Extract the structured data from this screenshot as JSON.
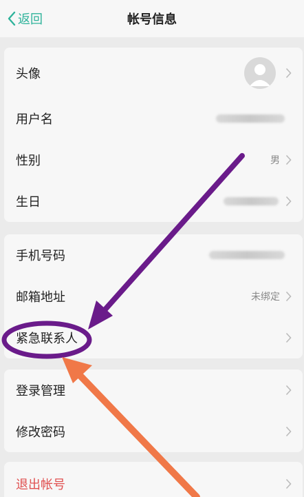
{
  "navbar": {
    "back_label": "返回",
    "title": "帐号信息"
  },
  "group1": {
    "avatar_label": "头像",
    "username_label": "用户名",
    "gender_label": "性别",
    "gender_value": "男",
    "birthday_label": "生日"
  },
  "group2": {
    "phone_label": "手机号码",
    "email_label": "邮箱地址",
    "email_value": "未绑定",
    "emergency_label": "紧急联系人"
  },
  "group3": {
    "login_mgmt_label": "登录管理",
    "change_password_label": "修改密码"
  },
  "group4": {
    "logout_label": "退出帐号"
  },
  "colors": {
    "accent": "#2fb39b",
    "logout": "#e05050",
    "annotation_purple": "#6a1b8a",
    "annotation_orange": "#f07848"
  }
}
